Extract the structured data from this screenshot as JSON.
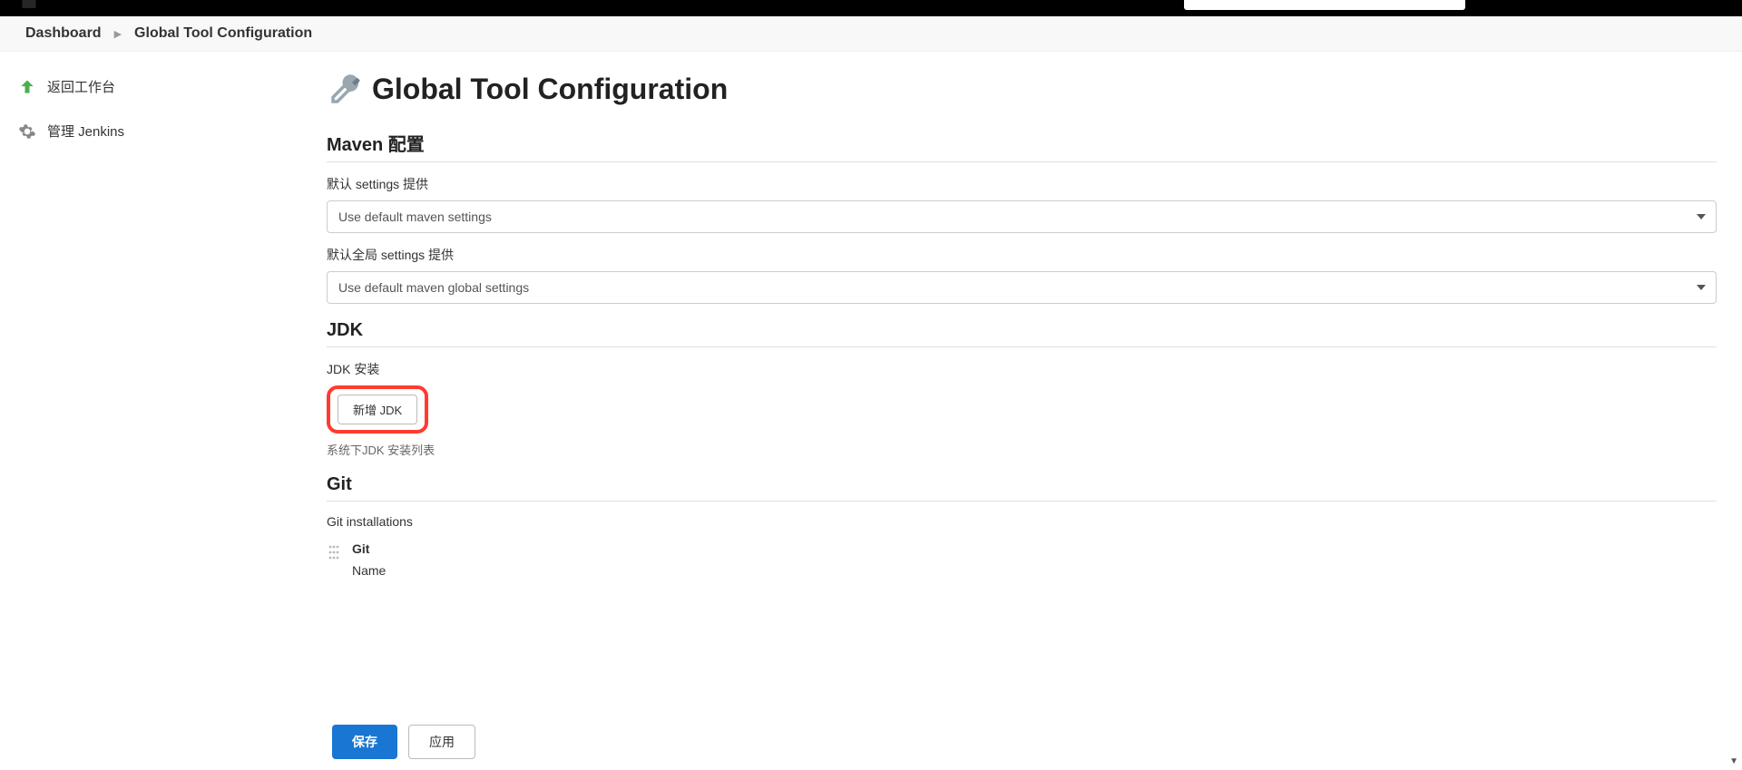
{
  "breadcrumb": {
    "dashboard": "Dashboard",
    "page": "Global Tool Configuration"
  },
  "sidebar": {
    "back_label": "返回工作台",
    "manage_label": "管理 Jenkins"
  },
  "page": {
    "title": "Global Tool Configuration"
  },
  "maven": {
    "section_title": "Maven 配置",
    "settings_label": "默认 settings 提供",
    "settings_value": "Use default maven settings",
    "global_settings_label": "默认全局 settings 提供",
    "global_settings_value": "Use default maven global settings"
  },
  "jdk": {
    "section_title": "JDK",
    "install_label": "JDK 安装",
    "add_button": "新增 JDK",
    "helper": "系统下JDK 安装列表"
  },
  "git": {
    "section_title": "Git",
    "installations_label": "Git installations",
    "entry_title": "Git",
    "name_label": "Name"
  },
  "footer": {
    "save": "保存",
    "apply": "应用"
  }
}
